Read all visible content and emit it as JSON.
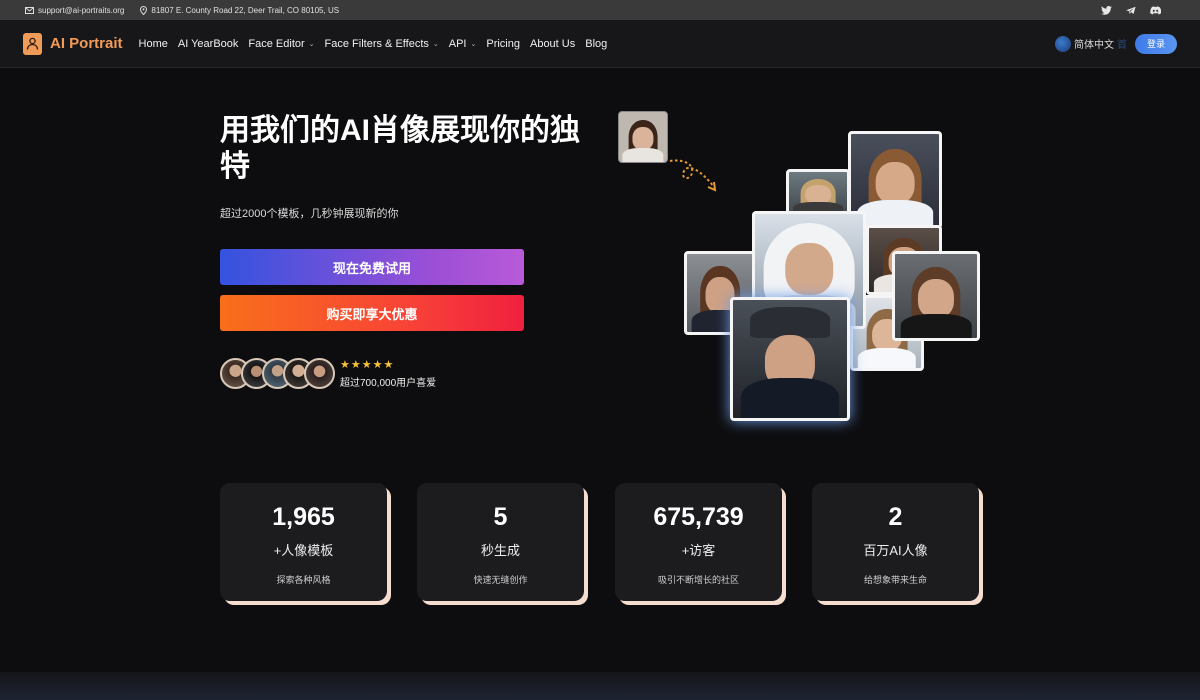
{
  "topbar": {
    "email": "support@ai-portraits.org",
    "address": "81807 E. County Road 22, Deer Trail, CO 80105, US",
    "socials": [
      "twitter-icon",
      "telegram-icon",
      "discord-icon"
    ]
  },
  "nav": {
    "logo_text": "AI Portrait",
    "items": [
      {
        "label": "Home",
        "dropdown": false
      },
      {
        "label": "AI YearBook",
        "dropdown": false
      },
      {
        "label": "Face Editor",
        "dropdown": true
      },
      {
        "label": "Face Filters & Effects",
        "dropdown": true
      },
      {
        "label": "API",
        "dropdown": true
      },
      {
        "label": "Pricing",
        "dropdown": false
      },
      {
        "label": "About Us",
        "dropdown": false
      },
      {
        "label": "Blog",
        "dropdown": false
      }
    ],
    "language": "简体中文",
    "language_ghost": "首",
    "login_label": "登录"
  },
  "hero": {
    "title": "用我们的AI肖像展现你的独特",
    "subtitle": "超过2000个模板，几秒钟展现新的你",
    "try_button": "现在免费试用",
    "buy_button": "购买即享大优惠",
    "rating_stars": 5,
    "rating_text": "超过700,000用户喜爱"
  },
  "stats": [
    {
      "number": "1,965",
      "label": "+人像模板",
      "desc": "探索各种风格"
    },
    {
      "number": "5",
      "label": "秒生成",
      "desc": "快速无缝创作"
    },
    {
      "number": "675,739",
      "label": "+访客",
      "desc": "吸引不断增长的社区"
    },
    {
      "number": "2",
      "label": "百万AI人像",
      "desc": "给想象带来生命"
    }
  ],
  "colors": {
    "brand": "#f19b59",
    "accent_blue": "#3e7be8",
    "star": "#f7c23a",
    "card_shadow": "#f5ddd0"
  }
}
